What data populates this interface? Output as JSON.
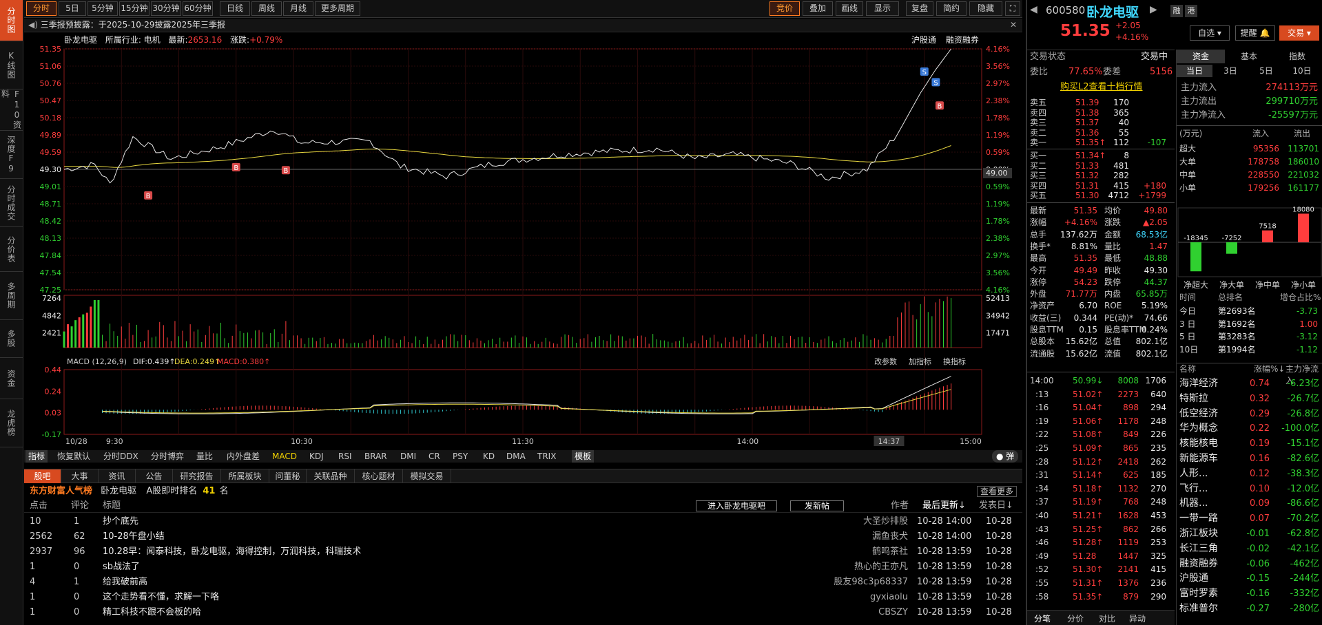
{
  "left_tabs": [
    "分时图",
    "K线图",
    "F10资料",
    "深度F9",
    "分时成交",
    "分价表",
    "多周期",
    "多股",
    "资金",
    "龙虎榜"
  ],
  "toolbar": {
    "periods": [
      "分时",
      "5日",
      "5分钟",
      "15分钟",
      "30分钟",
      "60分钟",
      "日线",
      "周线",
      "月线",
      "更多周期"
    ],
    "right": [
      "竞价",
      "叠加",
      "画线",
      "显示",
      "复盘",
      "简约",
      "隐藏"
    ]
  },
  "notice": "三季报预披露：于2025-10-29披露2025年三季报",
  "chart_header": {
    "name": "卧龙电驱",
    "industry": "所属行业: 电机",
    "latest_label": "最新:",
    "latest": "2653.16",
    "change_label": "涨跌:",
    "change": "+0.79%",
    "links": [
      "沪股通",
      "融资融券"
    ]
  },
  "price_axis": {
    "left": [
      "51.35",
      "51.06",
      "50.76",
      "50.47",
      "50.18",
      "49.89",
      "49.59",
      "49.30",
      "49.01",
      "48.71",
      "48.42",
      "48.13",
      "47.84",
      "47.54",
      "47.25"
    ],
    "right": [
      "4.16%",
      "3.56%",
      "2.97%",
      "2.38%",
      "1.78%",
      "1.19%",
      "0.59%",
      "0.00%",
      "0.59%",
      "1.19%",
      "1.78%",
      "2.38%",
      "2.97%",
      "3.56%",
      "4.16%"
    ],
    "cursor": "49.00"
  },
  "volume_axis": {
    "left": [
      "7264",
      "4842",
      "2421"
    ],
    "right": [
      "52413",
      "34942",
      "17471"
    ]
  },
  "macd": {
    "title": "MACD (12,26,9)",
    "dif": "DIF:0.439↑",
    "dea": "DEA:0.249↑",
    "macd": "MACD:0.380↑",
    "axis": [
      "0.44",
      "0.24",
      "0.03",
      "-0.17"
    ],
    "buttons": [
      "改参数",
      "加指标",
      "换指标"
    ]
  },
  "time_axis": [
    "10/28",
    "9:30",
    "10:30",
    "11:30",
    "14:00",
    "14:37",
    "15:00"
  ],
  "indicators": [
    "指标",
    "恢复默认",
    "分时DDX",
    "分时博弈",
    "量比",
    "内外盘差",
    "MACD",
    "KDJ",
    "RSI",
    "BRAR",
    "DMI",
    "CR",
    "PSY",
    "KD",
    "DMA",
    "TRIX",
    "模板"
  ],
  "bottom_tabs": [
    "股吧",
    "大事",
    "资讯",
    "公告",
    "研究报告",
    "所属板块",
    "问董秘",
    "关联品种",
    "核心题材",
    "模拟交易"
  ],
  "forum": {
    "brand": "东方财富人气榜",
    "stock": "卧龙电驱",
    "rank_label": "A股即时排名",
    "rank": "41",
    "rank_unit": "名",
    "more": "查看更多",
    "enter": "进入卧龙电驱吧",
    "post": "发新帖",
    "headers": [
      "点击",
      "评论",
      "标题",
      "作者",
      "最后更新↓",
      "发表日↓"
    ],
    "rows": [
      {
        "clicks": "10",
        "comments": "1",
        "title": "抄个底先",
        "author": "大圣炒排股",
        "updated": "10-28 14:00",
        "date": "10-28"
      },
      {
        "clicks": "2562",
        "comments": "62",
        "title": "10-28午盘小结",
        "author": "漏鱼丧犬",
        "updated": "10-28 14:00",
        "date": "10-28"
      },
      {
        "clicks": "2937",
        "comments": "96",
        "title": "10.28早：闻泰科技，卧龙电驱，海得控制，万润科技，科瑞技术",
        "author": "鹤鸣茶社",
        "updated": "10-28 13:59",
        "date": "10-28"
      },
      {
        "clicks": "1",
        "comments": "0",
        "title": "sb战法了",
        "author": "热心的王亦凡",
        "updated": "10-28 13:59",
        "date": "10-28"
      },
      {
        "clicks": "4",
        "comments": "1",
        "title": "给我破前高",
        "author": "股友98c3p68337",
        "updated": "10-28 13:59",
        "date": "10-28"
      },
      {
        "clicks": "1",
        "comments": "0",
        "title": "这个走势看不懂，求解一下咯",
        "author": "gyxiaolu",
        "updated": "10-28 13:59",
        "date": "10-28"
      },
      {
        "clicks": "1",
        "comments": "0",
        "title": "精工科技不跟不会板的哈",
        "author": "CBSZY",
        "updated": "10-28 13:59",
        "date": "10-28"
      }
    ]
  },
  "quote": {
    "code": "600580",
    "name": "卧龙电驱",
    "price": "51.35",
    "chg": "+2.05",
    "pct": "+4.16%",
    "btn1": "融",
    "btn2": "港",
    "self_select": "自选",
    "remind": "提醒",
    "trade": "交易",
    "status_label": "交易状态",
    "status": "交易中",
    "wb_label": "委比",
    "wb": "77.65%",
    "wc_label": "委差",
    "wc": "5156",
    "l2": "购买L2查看十档行情",
    "asks": [
      {
        "l": "卖五",
        "p": "51.39",
        "v": "170",
        "d": ""
      },
      {
        "l": "卖四",
        "p": "51.38",
        "v": "365",
        "d": ""
      },
      {
        "l": "卖三",
        "p": "51.37",
        "v": "40",
        "d": ""
      },
      {
        "l": "卖二",
        "p": "51.36",
        "v": "55",
        "d": ""
      },
      {
        "l": "卖一",
        "p": "51.35↑",
        "v": "112",
        "d": "-107"
      }
    ],
    "bids": [
      {
        "l": "买一",
        "p": "51.34↑",
        "v": "8",
        "d": ""
      },
      {
        "l": "买二",
        "p": "51.33",
        "v": "481",
        "d": ""
      },
      {
        "l": "买三",
        "p": "51.32",
        "v": "282",
        "d": ""
      },
      {
        "l": "买四",
        "p": "51.31",
        "v": "415",
        "d": "+180"
      },
      {
        "l": "买五",
        "p": "51.30",
        "v": "4712",
        "d": "+1799"
      }
    ],
    "stats": [
      [
        "最新",
        "51.35",
        "均价",
        "49.80"
      ],
      [
        "涨幅",
        "+4.16%",
        "涨跌",
        "▲2.05"
      ],
      [
        "总手",
        "137.62万",
        "金额",
        "68.53亿"
      ],
      [
        "换手*",
        "8.81%",
        "量比",
        "1.47"
      ],
      [
        "最高",
        "51.35",
        "最低",
        "48.88"
      ],
      [
        "今开",
        "49.49",
        "昨收",
        "49.30"
      ],
      [
        "涨停",
        "54.23",
        "跌停",
        "44.37"
      ],
      [
        "外盘",
        "71.77万",
        "内盘",
        "65.85万"
      ],
      [
        "净资产",
        "6.70",
        "ROE",
        "5.19%"
      ],
      [
        "收益(三)",
        "0.344",
        "PE(动)*",
        "74.66"
      ],
      [
        "股息TTM",
        "0.15",
        "股息率TTM",
        "0.24%"
      ],
      [
        "总股本",
        "15.62亿",
        "总值",
        "802.1亿"
      ],
      [
        "流通股",
        "15.62亿",
        "流值",
        "802.1亿"
      ]
    ],
    "ticks": [
      [
        "14:00",
        "50.99↓",
        "8008",
        "1706"
      ],
      [
        ":13",
        "51.02↑",
        "2273",
        "640"
      ],
      [
        ":16",
        "51.04↑",
        "898",
        "294"
      ],
      [
        ":19",
        "51.06↑",
        "1178",
        "248"
      ],
      [
        ":22",
        "51.08↑",
        "849",
        "226"
      ],
      [
        ":25",
        "51.09↑",
        "865",
        "235"
      ],
      [
        ":28",
        "51.12↑",
        "2418",
        "262"
      ],
      [
        ":31",
        "51.14↑",
        "625",
        "185"
      ],
      [
        ":34",
        "51.18↑",
        "1132",
        "270"
      ],
      [
        ":37",
        "51.19↑",
        "768",
        "248"
      ],
      [
        ":40",
        "51.21↑",
        "1628",
        "453"
      ],
      [
        ":43",
        "51.25↑",
        "862",
        "266"
      ],
      [
        ":46",
        "51.28↑",
        "1119",
        "253"
      ],
      [
        ":49",
        "51.28",
        "1447",
        "325"
      ],
      [
        ":52",
        "51.30↑",
        "2141",
        "415"
      ],
      [
        ":55",
        "51.31↑",
        "1376",
        "236"
      ],
      [
        ":58",
        "51.35↑",
        "879",
        "290"
      ]
    ],
    "tick_tabs": [
      "分笔",
      "分价",
      "对比",
      "异动"
    ]
  },
  "fund": {
    "tabs": [
      "资金",
      "基本",
      "指数"
    ],
    "subtabs": [
      "当日",
      "3日",
      "5日",
      "10日"
    ],
    "inflow_label": "主力流入",
    "inflow": "274113万元",
    "outflow_label": "主力流出",
    "outflow": "299710万元",
    "net_label": "主力净流入",
    "net": "-25597万元",
    "table_head": [
      "(万元)",
      "流入",
      "流出"
    ],
    "table": [
      [
        "超大",
        "95356",
        "113701"
      ],
      [
        "大单",
        "178758",
        "186010"
      ],
      [
        "中单",
        "228550",
        "221032"
      ],
      [
        "小单",
        "179256",
        "161177"
      ]
    ],
    "bars": [
      {
        "name": "净超大",
        "value": -18345
      },
      {
        "name": "净大单",
        "value": -7252
      },
      {
        "name": "净中单",
        "value": 7518
      },
      {
        "name": "净小单",
        "value": 18080
      }
    ],
    "rank_head": [
      "时间",
      "总排名",
      "增仓占比%"
    ],
    "ranks": [
      [
        "今日",
        "第2693名",
        "-3.73"
      ],
      [
        "3 日",
        "第1692名",
        "1.00"
      ],
      [
        "5 日",
        "第3283名",
        "-3.12"
      ],
      [
        "10日",
        "第1994名",
        "-1.12"
      ]
    ],
    "sector_head": [
      "名称",
      "涨幅%↓",
      "主力净流入"
    ],
    "sectors": [
      [
        "海洋经济",
        "0.74",
        "-6.23亿"
      ],
      [
        "特斯拉",
        "0.32",
        "-26.7亿"
      ],
      [
        "低空经济",
        "0.29",
        "-26.8亿"
      ],
      [
        "华为概念",
        "0.22",
        "-100.0亿"
      ],
      [
        "核能核电",
        "0.19",
        "-15.1亿"
      ],
      [
        "新能源车",
        "0.16",
        "-82.6亿"
      ],
      [
        "人形...",
        "0.12",
        "-38.3亿"
      ],
      [
        "飞行...",
        "0.10",
        "-12.0亿"
      ],
      [
        "机器...",
        "0.09",
        "-86.6亿"
      ],
      [
        "一带一路",
        "0.07",
        "-70.2亿"
      ],
      [
        "浙江板块",
        "-0.01",
        "-62.8亿"
      ],
      [
        "长江三角",
        "-0.02",
        "-42.1亿"
      ],
      [
        "融资融券",
        "-0.06",
        "-462亿"
      ],
      [
        "沪股通",
        "-0.15",
        "-244亿"
      ],
      [
        "富时罗素",
        "-0.16",
        "-332亿"
      ],
      [
        "标准普尔",
        "-0.27",
        "-280亿"
      ]
    ]
  },
  "colors": {
    "up": "#ff3d3d",
    "down": "#30d030",
    "accent": "#d84a20",
    "avg": "#e8d840"
  }
}
